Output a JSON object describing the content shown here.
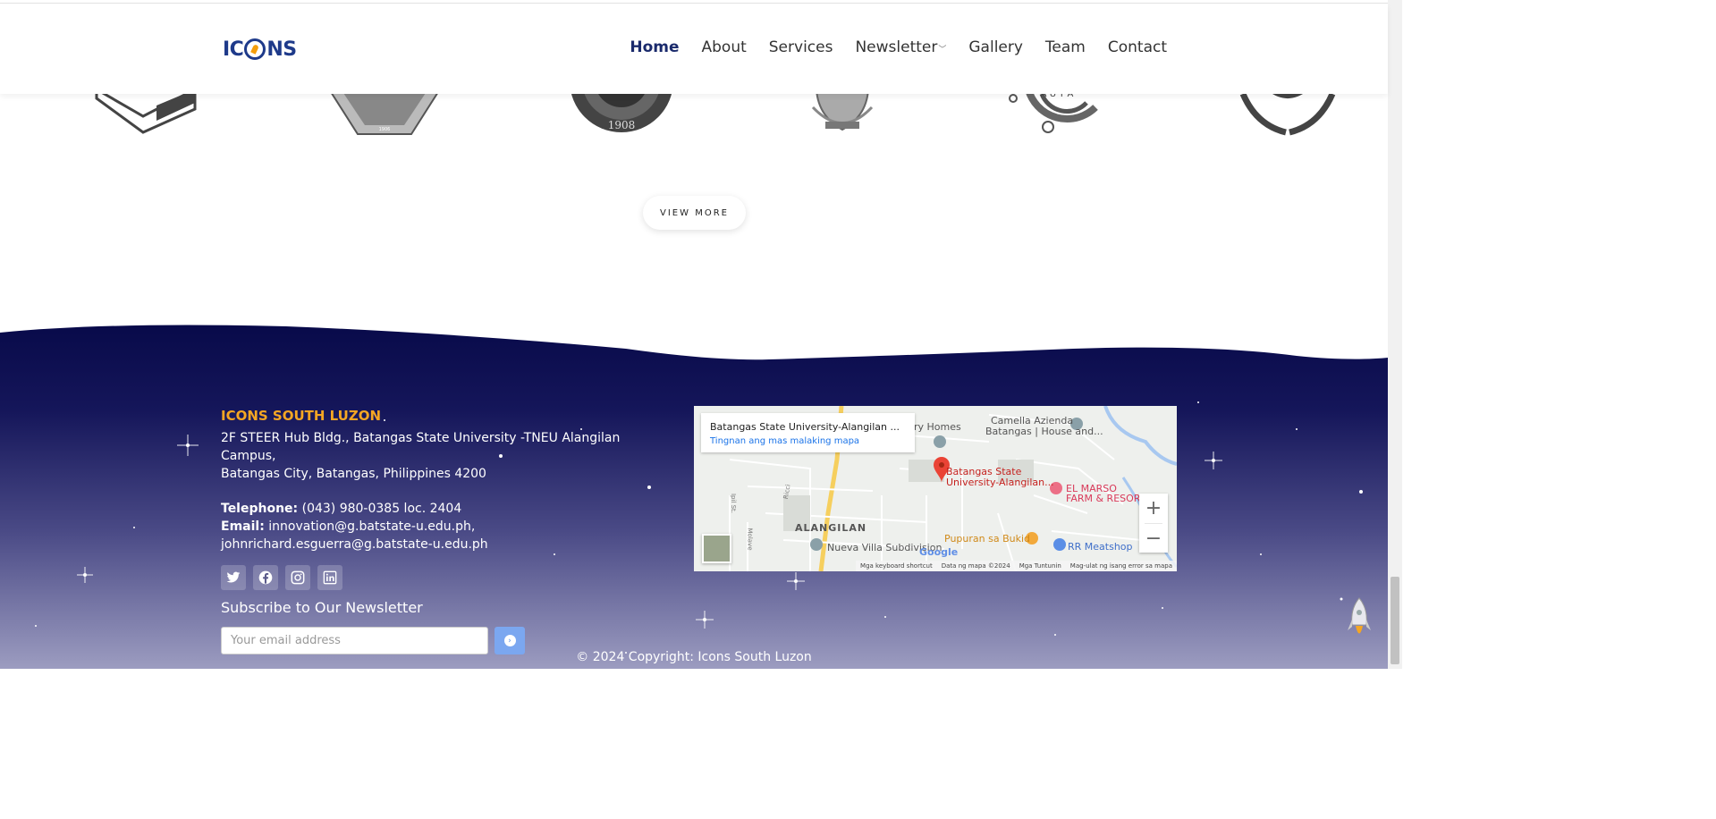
{
  "header": {
    "logo_text_left": "IC",
    "logo_text_right": "NS",
    "nav": [
      {
        "label": "Home",
        "active": true
      },
      {
        "label": "About",
        "active": false
      },
      {
        "label": "Services",
        "active": false
      },
      {
        "label": "Newsletter",
        "active": false,
        "dropdown": true
      },
      {
        "label": "Gallery",
        "active": false
      },
      {
        "label": "Team",
        "active": false
      },
      {
        "label": "Contact",
        "active": false
      }
    ]
  },
  "partners": {
    "seal_year": "1908"
  },
  "view_more_label": "VIEW MORE",
  "footer": {
    "title": "ICONS SOUTH LUZON",
    "address_line1": "2F STEER Hub Bldg., Batangas State University -TNEU Alangilan Campus,",
    "address_line2": "Batangas City, Batangas, Philippines 4200",
    "telephone_label": "Telephone:",
    "telephone_value": "(043) 980-0385 loc. 2404",
    "email_label": "Email:",
    "email_value1": "innovation@g.batstate-u.edu.ph,",
    "email_value2": "johnrichard.esguerra@g.batstate-u.edu.ph",
    "socials": [
      "twitter-icon",
      "facebook-icon",
      "instagram-icon",
      "linkedin-icon"
    ],
    "subscribe_title": "Subscribe to Our Newsletter",
    "email_placeholder": "Your email address",
    "copyright": "© 2024 Copyright: Icons South Luzon"
  },
  "map": {
    "card_title": "Batangas State University-Alangilan ...",
    "card_link": "Tingnan ang mas malaking mapa",
    "labels": {
      "camella": "Camella Azienda",
      "camella2": "Batangas | House and...",
      "homes": "ry Homes",
      "bsu1": "Batangas State",
      "bsu2": "University-Alangilan...",
      "marso1": "EL MARSO",
      "marso2": "FARM & RESORT",
      "alangilan": "ALANGILAN",
      "nueva": "Nueva Villa Subdivision",
      "pupuran": "Pupuran sa Bukid",
      "rr": "RR Meatshop",
      "ipil": "Ipil St.",
      "ricci": "Ricci",
      "molave": "Molave"
    },
    "footer": [
      "Mga keyboard shortcut",
      "Data ng mapa ©2024",
      "Mga Tuntunin",
      "Mag-ulat ng isang error sa mapa"
    ],
    "zoom_in": "+",
    "zoom_out": "−"
  },
  "colors": {
    "navy": "#0b0d52",
    "accent": "#f5a623",
    "nav_active": "#1a2a6c"
  }
}
